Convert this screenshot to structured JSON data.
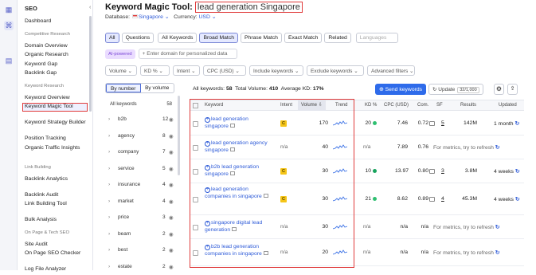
{
  "sidebar": {
    "title": "SEO",
    "items": [
      {
        "type": "item",
        "label": "Dashboard"
      },
      {
        "type": "section",
        "label": "Competitive Research"
      },
      {
        "type": "item",
        "label": "Domain Overview"
      },
      {
        "type": "item",
        "label": "Organic Research"
      },
      {
        "type": "item",
        "label": "Keyword Gap"
      },
      {
        "type": "item",
        "label": "Backlink Gap"
      },
      {
        "type": "section",
        "label": "Keyword Research"
      },
      {
        "type": "item",
        "label": "Keyword Overview"
      },
      {
        "type": "item",
        "label": "Keyword Magic Tool",
        "active": true
      },
      {
        "type": "item",
        "label": "Keyword Strategy Builder"
      },
      {
        "type": "item",
        "label": "Position Tracking"
      },
      {
        "type": "item",
        "label": "Organic Traffic Insights"
      },
      {
        "type": "section",
        "label": "Link Building"
      },
      {
        "type": "item",
        "label": "Backlink Analytics"
      },
      {
        "type": "item",
        "label": "Backlink Audit"
      },
      {
        "type": "item",
        "label": "Link Building Tool"
      },
      {
        "type": "item",
        "label": "Bulk Analysis"
      },
      {
        "type": "section",
        "label": "On Page & Tech SEO"
      },
      {
        "type": "item",
        "label": "Site Audit"
      },
      {
        "type": "item",
        "label": "On Page SEO Checker"
      },
      {
        "type": "item",
        "label": "Log File Analyzer"
      }
    ]
  },
  "header": {
    "title_prefix": "Keyword Magic Tool:",
    "keyword": "lead generation Singapore",
    "database_label": "Database:",
    "database_value": "Singapore",
    "currency_label": "Currency:",
    "currency_value": "USD"
  },
  "tabs": [
    "All",
    "Questions",
    "All Keywords",
    "Broad Match",
    "Phrase Match",
    "Exact Match",
    "Related",
    "Languages"
  ],
  "ai": {
    "badge": "AI-powered",
    "placeholder": "Enter domain for personalized data"
  },
  "filters": [
    "Volume",
    "KD %",
    "Intent",
    "CPC (USD)",
    "Include keywords",
    "Exclude keywords",
    "Advanced filters"
  ],
  "groups_panel": {
    "by_number": "By number",
    "by_volume": "By volume",
    "header_label": "All keywords",
    "header_count": "58",
    "groups": [
      {
        "name": "b2b",
        "count": "12"
      },
      {
        "name": "agency",
        "count": "8"
      },
      {
        "name": "company",
        "count": "7"
      },
      {
        "name": "service",
        "count": "5"
      },
      {
        "name": "insurance",
        "count": "4"
      },
      {
        "name": "market",
        "count": "4"
      },
      {
        "name": "price",
        "count": "3"
      },
      {
        "name": "beam",
        "count": "2"
      },
      {
        "name": "best",
        "count": "2"
      },
      {
        "name": "estate",
        "count": "2"
      }
    ]
  },
  "stats": {
    "all_label": "All keywords:",
    "all_value": "58",
    "vol_label": "Total Volume:",
    "vol_value": "410",
    "kd_label": "Average KD:",
    "kd_value": "17%"
  },
  "actions": {
    "send": "Send keywords",
    "update": "Update",
    "update_count": "32/1,000"
  },
  "columns": {
    "keyword": "Keyword",
    "intent": "Intent",
    "volume": "Volume",
    "trend": "Trend",
    "kd": "KD %",
    "cpc": "CPC (USD)",
    "com": "Com.",
    "sf": "SF",
    "results": "Results",
    "updated": "Updated"
  },
  "colors": {
    "kd_easy": "#2fbf71",
    "kd_hard": "#17a35d",
    "kd_mid": "#26b36a",
    "intent_c": "#f5c518",
    "accent": "#2e6bea",
    "highlight": "#e03b3b"
  },
  "rows": [
    {
      "keyword": "lead generation singapore",
      "intent": "C",
      "volume": "170",
      "kd": "20",
      "kd_dot": "#2fbf71",
      "cpc": "7.46",
      "com": "0.72",
      "sf": "5",
      "results": "142M",
      "updated": "1 month"
    },
    {
      "keyword": "lead generation agency singapore",
      "intent": "n/a",
      "volume": "40",
      "kd": "n/a",
      "cpc": "7.89",
      "com": "0.76",
      "metrics_msg": "For metrics, try to refresh"
    },
    {
      "keyword": "b2b lead generation singapore",
      "intent": "C",
      "volume": "30",
      "kd": "10",
      "kd_dot": "#17a35d",
      "cpc": "13.97",
      "com": "0.80",
      "sf": "3",
      "results": "3.8M",
      "updated": "4 weeks"
    },
    {
      "keyword": "lead generation companies in singapore",
      "intent": "C",
      "volume": "30",
      "kd": "21",
      "kd_dot": "#2fbf71",
      "cpc": "8.62",
      "com": "0.89",
      "sf": "4",
      "results": "45.3M",
      "updated": "4 weeks"
    },
    {
      "keyword": "singapore digital lead generation",
      "intent": "n/a",
      "volume": "30",
      "kd": "n/a",
      "cpc": "n/a",
      "com": "n/a",
      "metrics_msg": "For metrics, try to refresh"
    },
    {
      "keyword": "b2b lead generation companies in singapore",
      "intent": "n/a",
      "volume": "20",
      "kd": "n/a",
      "cpc": "n/a",
      "com": "n/a",
      "metrics_msg": "For metrics, try to refresh"
    }
  ]
}
